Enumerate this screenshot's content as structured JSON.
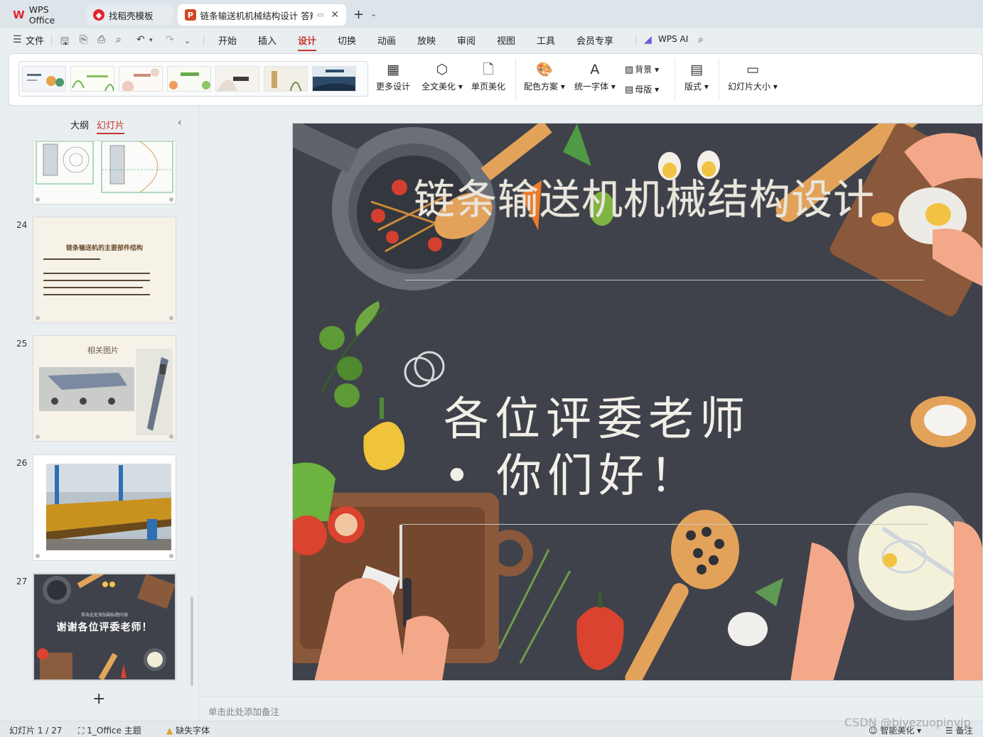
{
  "tabs": {
    "wps": "WPS Office",
    "templates": "找稻壳模板",
    "document": "链条输送机机械结构设计 答辩",
    "add": "+",
    "more": "⌄"
  },
  "menubar": {
    "file": "文件",
    "items": [
      "开始",
      "插入",
      "设计",
      "切换",
      "动画",
      "放映",
      "审阅",
      "视图",
      "工具",
      "会员专享"
    ],
    "active": "设计",
    "wps_ai": "WPS AI"
  },
  "ribbon": {
    "more_design": "更多设计",
    "full_beautify": "全文美化",
    "page_beautify": "单页美化",
    "color_scheme": "配色方案",
    "unify_font": "统一字体",
    "background": "背景",
    "master": "母版",
    "layout": "版式",
    "slide_size": "幻灯片大小"
  },
  "panel": {
    "outline_tab": "大纲",
    "slides_tab": "幻灯片",
    "slide_numbers": [
      "24",
      "25",
      "26",
      "27"
    ],
    "thumb24_title": "链条输送机的主要部件结构",
    "thumb25_title": "相关图片",
    "thumb27_sub": "单击此处添加副标题内容",
    "thumb27_title": "谢谢各位评委老师！",
    "add_slide": "+"
  },
  "slide": {
    "title": "链条输送机机械结构设计",
    "greeting_line1": "各位评委老师",
    "greeting_line2": "• 你们好！"
  },
  "notes": {
    "placeholder": "单击此处添加备注"
  },
  "status": {
    "slide_counter": "幻灯片 1 / 27",
    "theme": "1_Office 主题",
    "missing_font": "缺失字体",
    "smart_beautify": "智能美化",
    "notes": "备注"
  },
  "watermark": "CSDN @biyezuopinvip",
  "colors": {
    "accent": "#c7372b",
    "slide_bg": "#3f424a",
    "ui_bg": "#e9eef1"
  }
}
